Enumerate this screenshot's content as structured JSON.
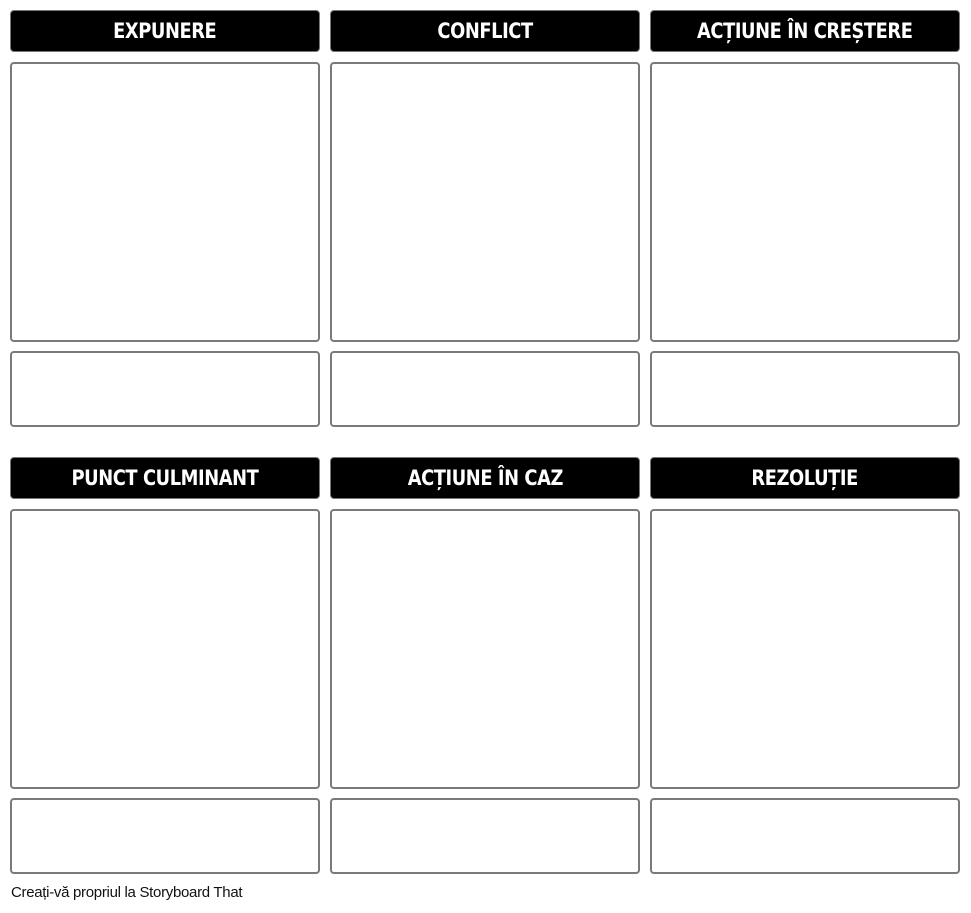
{
  "cells": [
    {
      "title": "EXPUNERE"
    },
    {
      "title": "CONFLICT"
    },
    {
      "title": "ACȚIUNE ÎN CREȘTERE"
    },
    {
      "title": "PUNCT CULMINANT"
    },
    {
      "title": "ACȚIUNE ÎN CAZ"
    },
    {
      "title": "REZOLUȚIE"
    }
  ],
  "footer": "Creați-vă propriul la Storyboard That"
}
